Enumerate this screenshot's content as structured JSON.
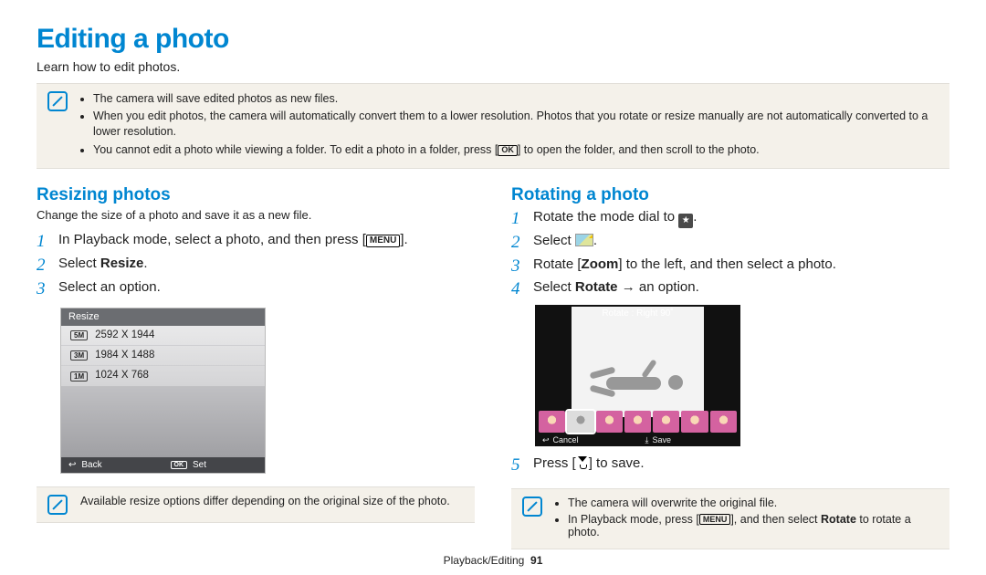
{
  "title": "Editing a photo",
  "subtitle": "Learn how to edit photos.",
  "notice": {
    "items": [
      "The camera will save edited photos as new files.",
      "When you edit photos, the camera will automatically convert them to a lower resolution. Photos that you rotate or resize manually are not automatically converted to a lower resolution.",
      "You cannot edit a photo while viewing a folder. To edit a photo in a folder, press [        ] to open the folder, and then scroll to the photo."
    ],
    "ok_label": "OK"
  },
  "left": {
    "heading": "Resizing photos",
    "sub": "Change the size of a photo and save it as a new file.",
    "steps": {
      "s1a": "In Playback mode, select a photo, and then press [",
      "menu_label": "MENU",
      "s1b": "].",
      "s2a": "Select ",
      "s2b": "Resize",
      "s2c": ".",
      "s3": "Select an option."
    },
    "panel": {
      "title": "Resize",
      "rows": [
        "2592 X 1944",
        "1984 X 1488",
        "1024 X 768"
      ],
      "tags": [
        "5M",
        "3M",
        "1M"
      ],
      "back": "Back",
      "set": "Set",
      "ok": "OK"
    },
    "tip": "Available resize options differ depending on the original size of the photo."
  },
  "right": {
    "heading": "Rotating a photo",
    "steps": {
      "s1a": "Rotate the mode dial to ",
      "s1b": ".",
      "mode_star": "★",
      "s2a": "Select ",
      "s2b": ".",
      "s3a": "Rotate [",
      "s3b": "Zoom",
      "s3c": "] to the left, and then select a photo.",
      "s4a": "Select ",
      "s4b": "Rotate",
      "s4c": " → an option.",
      "s5a": "Press [",
      "s5b": "] to save."
    },
    "panel": {
      "title": "Rotate : Right 90˚",
      "cancel": "Cancel",
      "save": "Save"
    },
    "tip": {
      "a": "The camera will overwrite the original file.",
      "b1": "In Playback mode, press [",
      "menu_label": "MENU",
      "b2": "], and then select ",
      "b3": "Rotate",
      "b4": " to rotate a photo."
    }
  },
  "footer": {
    "section": "Playback/Editing",
    "page": "91"
  }
}
